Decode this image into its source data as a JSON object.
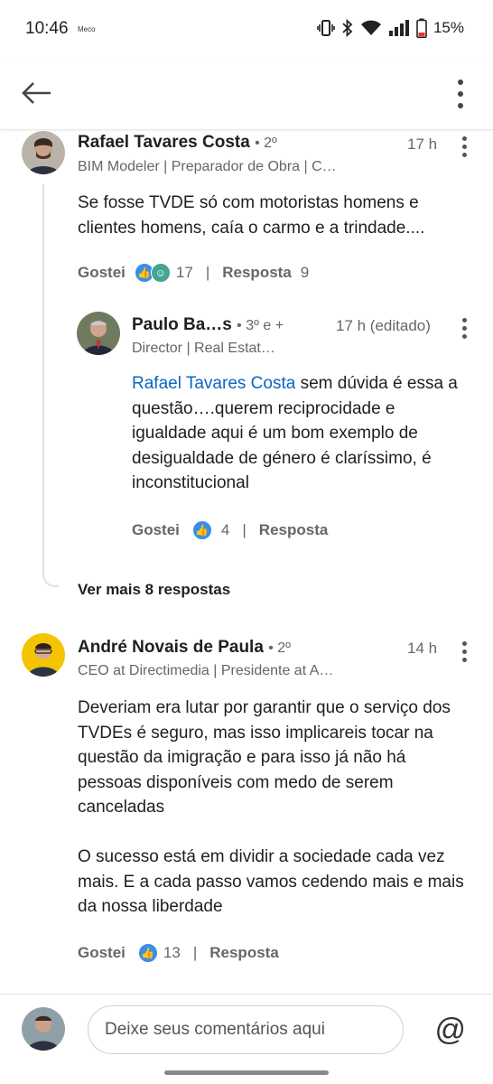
{
  "status": {
    "time": "10:46",
    "carrier": "Meco",
    "battery": "15%"
  },
  "comments": [
    {
      "name": "Rafael Tavares Costa",
      "degree": "• 2º",
      "headline": "BIM Modeler | Preparador de Obra | C…",
      "time": "17 h",
      "text": "Se fosse TVDE só com motoristas homens e clientes homens, caía o carmo e a trindade....",
      "like_label": "Gostei",
      "reactions": "17",
      "sep": "|",
      "reply_label": "Resposta",
      "replies": "9"
    },
    {
      "name": "Paulo Ba…s",
      "degree": "• 3º e +",
      "headline": "Director | Real Estat…",
      "time": "17 h (editado)",
      "mention": "Rafael Tavares Costa",
      "text": " sem dúvida é essa a questão….querem reciprocidade e igualdade aqui é um bom exemplo de desigualdade de género é claríssimo, é inconstitucional",
      "like_label": "Gostei",
      "reactions": "4",
      "sep": "|",
      "reply_label": "Resposta"
    },
    {
      "name": "André Novais de Paula",
      "degree": "• 2º",
      "headline": "CEO at Directimedia | Presidente at A…",
      "time": "14 h",
      "text": "Deveriam era lutar por garantir que o serviço dos TVDEs é seguro, mas isso implicareis tocar na questão da imigração e para isso já não há pessoas disponíveis com medo de serem canceladas",
      "text2": "O sucesso está em dividir a sociedade cada vez mais. E a cada passo vamos cedendo mais e mais da nossa liberdade",
      "like_label": "Gostei",
      "reactions": "13",
      "sep": "|",
      "reply_label": "Resposta"
    }
  ],
  "see_more": "Ver mais 8 respostas",
  "composer": {
    "placeholder": "Deixe seus comentários aqui",
    "at": "@"
  },
  "colors": {
    "link": "#0a66c2",
    "like": "#378fe9",
    "celebrate": "#44a68f"
  }
}
